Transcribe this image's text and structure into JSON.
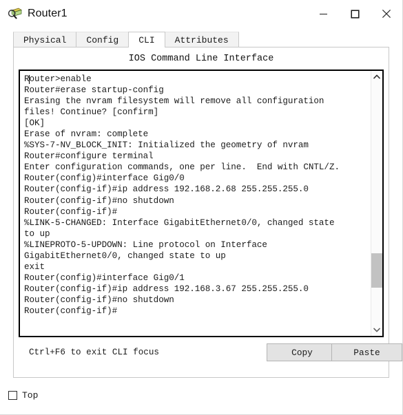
{
  "window": {
    "title": "Router1",
    "icon": "router-device-icon",
    "controls": [
      {
        "name": "minimize-button",
        "glyph": "minimize-icon"
      },
      {
        "name": "maximize-button",
        "glyph": "maximize-icon"
      },
      {
        "name": "close-button",
        "glyph": "close-icon"
      }
    ]
  },
  "tabs": [
    {
      "label": "Physical",
      "active": false
    },
    {
      "label": "Config",
      "active": false
    },
    {
      "label": "CLI",
      "active": true
    },
    {
      "label": "Attributes",
      "active": false
    }
  ],
  "panel": {
    "heading": "IOS Command Line Interface",
    "hint": "Ctrl+F6 to exit CLI focus",
    "copy_label": "Copy",
    "paste_label": "Paste"
  },
  "terminal": {
    "lines": [
      "Router>enable",
      "Router#erase startup-config",
      "Erasing the nvram filesystem will remove all configuration",
      "files! Continue? [confirm]",
      "[OK]",
      "Erase of nvram: complete",
      "%SYS-7-NV_BLOCK_INIT: Initialized the geometry of nvram",
      "Router#configure terminal",
      "Enter configuration commands, one per line.  End with CNTL/Z.",
      "Router(config)#interface Gig0/0",
      "Router(config-if)#ip address 192.168.2.68 255.255.255.0",
      "Router(config-if)#no shutdown",
      "",
      "Router(config-if)#",
      "%LINK-5-CHANGED: Interface GigabitEthernet0/0, changed state",
      "to up",
      "",
      "%LINEPROTO-5-UPDOWN: Line protocol on Interface",
      "GigabitEthernet0/0, changed state to up",
      "exit",
      "Router(config)#interface Gig0/1",
      "Router(config-if)#ip address 192.168.3.67 255.255.255.0",
      "Router(config-if)#no shutdown",
      "",
      "Router(config-if)#"
    ],
    "scrollbar": {
      "up_arrow": "chevron-up-icon",
      "down_arrow": "chevron-down-icon"
    }
  },
  "bottom": {
    "top_checkbox_label": "Top",
    "top_checkbox_checked": false
  },
  "colors": {
    "window_bg": "#ffffff",
    "tab_inactive_bg": "#f2f2f2",
    "tab_active_bg": "#ffffff",
    "border": "#c8c8c8",
    "terminal_border": "#000000",
    "button_bg": "#e3e3e3",
    "scrollbar_thumb": "#c2c2c2",
    "text": "#1b1b1b"
  }
}
